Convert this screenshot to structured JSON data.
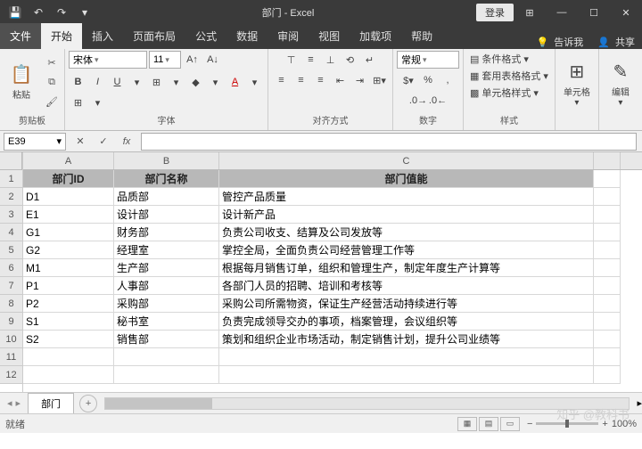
{
  "title": "部门 - Excel",
  "login_label": "登录",
  "qat": {
    "save": "💾",
    "undo": "↶",
    "redo": "↷",
    "more": "▾"
  },
  "win": {
    "opts": "⊞",
    "min": "—",
    "max": "☐",
    "close": "✕"
  },
  "tabs": {
    "file": "文件",
    "home": "开始",
    "insert": "插入",
    "layout": "页面布局",
    "formulas": "公式",
    "data": "数据",
    "review": "审阅",
    "view": "视图",
    "addins": "加载项",
    "help": "帮助",
    "tellme": "告诉我",
    "share": "共享"
  },
  "ribbon": {
    "clipboard": {
      "label": "剪贴板",
      "paste": "粘贴"
    },
    "font": {
      "label": "字体",
      "name": "宋体",
      "size": "11",
      "bold": "B",
      "italic": "I",
      "underline": "U",
      "border": "⊞",
      "fill": "◆",
      "color": "A"
    },
    "align": {
      "label": "对齐方式"
    },
    "number": {
      "label": "数字",
      "format": "常规"
    },
    "styles": {
      "label": "样式",
      "cond": "条件格式",
      "tablefmt": "套用表格格式",
      "cellstyle": "单元格样式"
    },
    "cells": {
      "label": "单元格"
    },
    "editing": {
      "label": "编辑"
    }
  },
  "namebox": {
    "value": "E39"
  },
  "columns": [
    "A",
    "B",
    "C"
  ],
  "headers": {
    "A": "部门ID",
    "B": "部门名称",
    "C": "部门值能"
  },
  "rows": [
    {
      "n": "2",
      "A": "D1",
      "B": "品质部",
      "C": "管控产品质量"
    },
    {
      "n": "3",
      "A": "E1",
      "B": "设计部",
      "C": "设计新产品"
    },
    {
      "n": "4",
      "A": "G1",
      "B": "财务部",
      "C": "负责公司收支、结算及公司发放等"
    },
    {
      "n": "5",
      "A": "G2",
      "B": "经理室",
      "C": "掌控全局，全面负责公司经营管理工作等"
    },
    {
      "n": "6",
      "A": "M1",
      "B": "生产部",
      "C": "根据每月销售订单，组织和管理生产，制定年度生产计算等"
    },
    {
      "n": "7",
      "A": "P1",
      "B": "人事部",
      "C": "各部门人员的招聘、培训和考核等"
    },
    {
      "n": "8",
      "A": "P2",
      "B": "采购部",
      "C": "采购公司所需物资，保证生产经营活动持续进行等"
    },
    {
      "n": "9",
      "A": "S1",
      "B": "秘书室",
      "C": "负责完成领导交办的事项，档案管理，会议组织等"
    },
    {
      "n": "10",
      "A": "S2",
      "B": "销售部",
      "C": "策划和组织企业市场活动，制定销售计划，提升公司业绩等"
    },
    {
      "n": "11",
      "A": "",
      "B": "",
      "C": ""
    },
    {
      "n": "12",
      "A": "",
      "B": "",
      "C": ""
    }
  ],
  "sheet": {
    "name": "部门"
  },
  "status": {
    "ready": "就绪",
    "zoom": "100%"
  },
  "watermark": "知乎 @教科书"
}
